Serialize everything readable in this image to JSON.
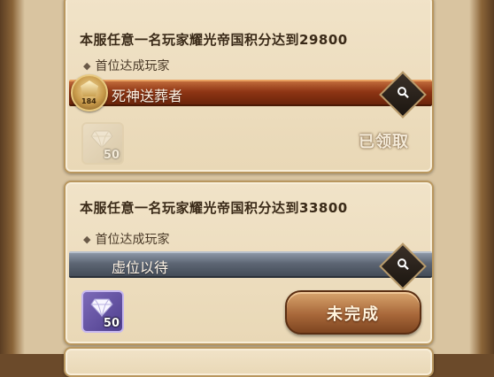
{
  "tasks": [
    {
      "title": "本服任意一名玩家耀光帝国积分达到29800",
      "subtitle": "首位达成玩家",
      "player_name": "死神送葬者",
      "avatar_level": "184",
      "reward_count": "50",
      "status": "已领取",
      "ribbon_color": "#8e3514"
    },
    {
      "title": "本服任意一名玩家耀光帝国积分达到33800",
      "subtitle": "首位达成玩家",
      "player_name": "虚位以待",
      "reward_count": "50",
      "action_label": "未完成",
      "ribbon_color": "#5d6674"
    }
  ],
  "icons": {
    "search": "magnifier-icon",
    "reward": "diamond-icon",
    "bullet": "diamond-bullet-icon"
  }
}
